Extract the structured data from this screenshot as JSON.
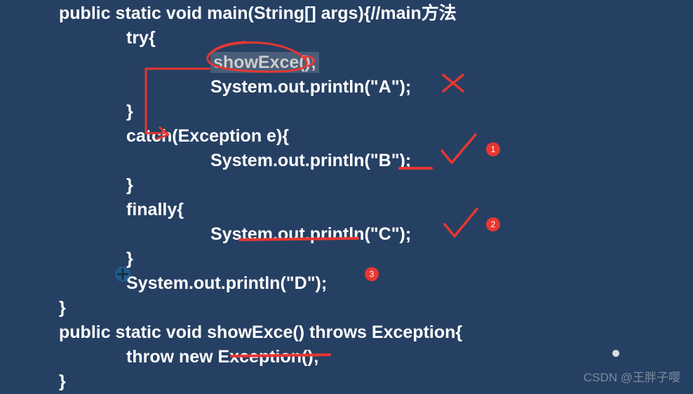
{
  "code": {
    "l1_a": "public static void main(String[] args){",
    "l1_b": "//main方法",
    "l2": "try{",
    "l3": "showExce();",
    "l4": "System.out.println(\"A\");",
    "l5": "}",
    "l6": "catch(Exception e){",
    "l7": "System.out.println(\"B\");",
    "l8": "}",
    "l9": "finally{",
    "l10": "System.out.println(\"C\");",
    "l11": "}",
    "l12": "System.out.println(\"D\");",
    "l13": "}",
    "l14": "public static void showExce() throws Exception{",
    "l15": "throw new Exception();",
    "l16": "}"
  },
  "badges": {
    "b1": "1",
    "b2": "2",
    "b3": "3"
  },
  "colors": {
    "annotation": "#e63731",
    "background": "#264063",
    "text": "#ffffff"
  },
  "watermark": "CSDN @王胖子嘤"
}
